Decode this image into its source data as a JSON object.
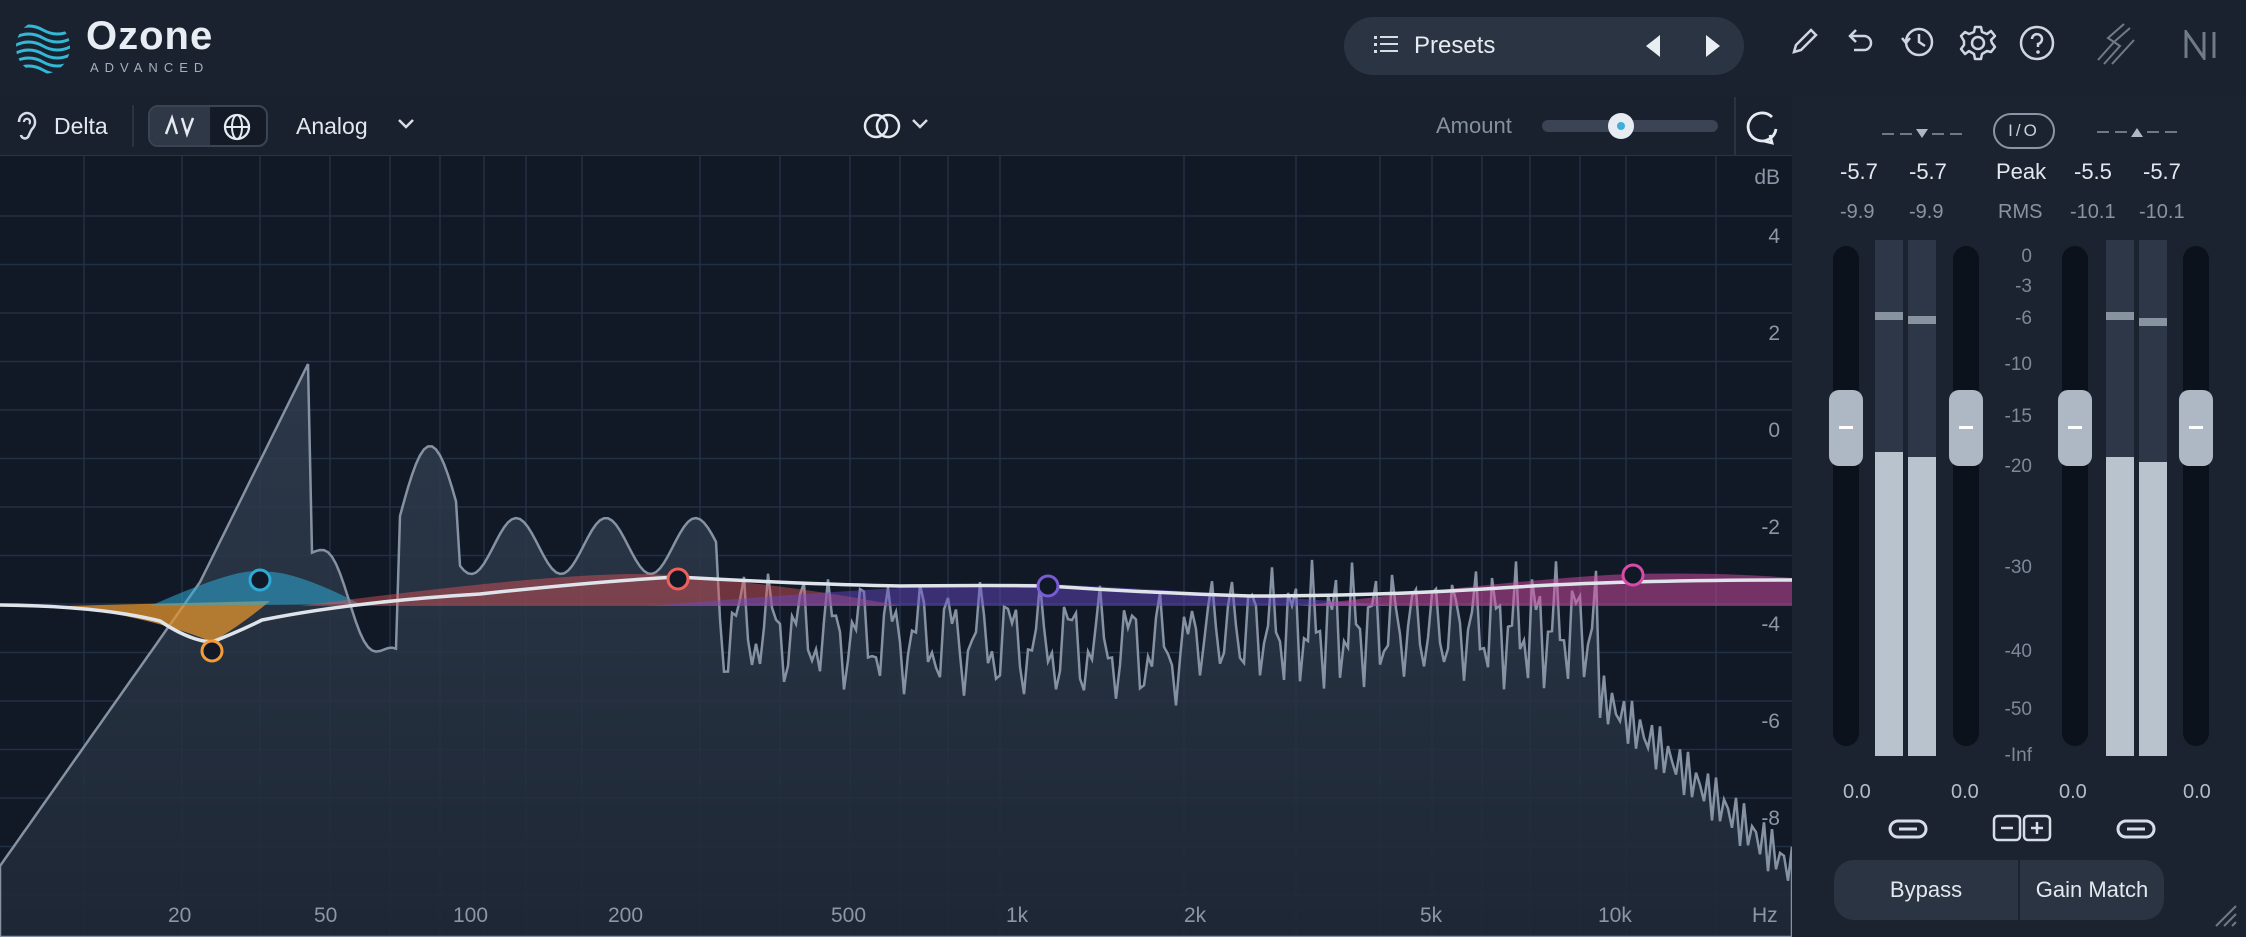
{
  "app": {
    "name": "Ozone",
    "edition": "ADVANCED"
  },
  "header": {
    "presets_label": "Presets"
  },
  "toolbar": {
    "delta_label": "Delta",
    "mode_label": "Analog",
    "amount_label": "Amount",
    "amount_value": 0.45
  },
  "eq": {
    "db_unit": "dB",
    "hz_unit": "Hz",
    "db_ticks": [
      "4",
      "2",
      "0",
      "-2",
      "-4",
      "-6",
      "-8"
    ],
    "freq_ticks": [
      "20",
      "50",
      "100",
      "200",
      "500",
      "1k",
      "2k",
      "5k",
      "10k"
    ],
    "nodes": [
      {
        "name": "band-1",
        "color": "#f39b3a"
      },
      {
        "name": "band-2",
        "color": "#2fa9d6"
      },
      {
        "name": "band-3",
        "color": "#f0605a"
      },
      {
        "name": "band-4",
        "color": "#7a5bd6"
      },
      {
        "name": "band-5",
        "color": "#d84ba8"
      }
    ]
  },
  "meters": {
    "io_label": "I/O",
    "peak_label": "Peak",
    "rms_label": "RMS",
    "input_peak": [
      "-5.7",
      "-5.7"
    ],
    "input_rms": [
      "-9.9",
      "-9.9"
    ],
    "output_peak": [
      "-5.5",
      "-5.7"
    ],
    "output_rms": [
      "-10.1",
      "-10.1"
    ],
    "scale": [
      "0",
      "-3",
      "-6",
      "-10",
      "-15",
      "-20",
      "-30",
      "-40",
      "-50",
      "-Inf"
    ],
    "gain_values": [
      "0.0",
      "0.0",
      "0.0",
      "0.0"
    ],
    "input_levels": [
      0.59,
      0.58
    ],
    "output_levels": [
      0.58,
      0.57
    ]
  },
  "footer": {
    "bypass_label": "Bypass",
    "gain_match_label": "Gain Match"
  }
}
